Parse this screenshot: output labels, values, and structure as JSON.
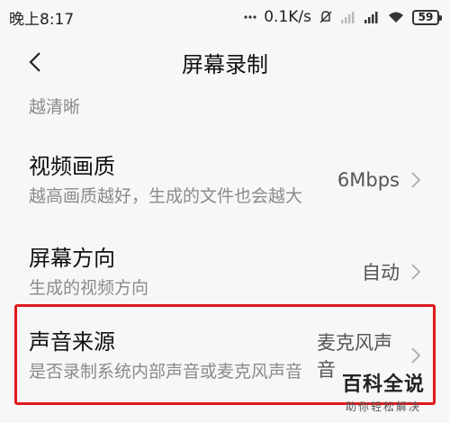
{
  "status": {
    "time": "晚上8:17",
    "net_speed": "0.1K/s",
    "battery": "59"
  },
  "header": {
    "title": "屏幕录制"
  },
  "list": {
    "partial_text": "越清晰",
    "items": [
      {
        "title": "视频画质",
        "subtitle": "越高画质越好，生成的文件也会越大",
        "value": "6Mbps"
      },
      {
        "title": "屏幕方向",
        "subtitle": "生成的视频方向",
        "value": "自动"
      },
      {
        "title": "声音来源",
        "subtitle": "是否录制系统内部声音或麦克风声音",
        "value": "麦克风声音"
      }
    ]
  },
  "watermark": {
    "main": "百科全说",
    "sub": "助你轻松解决"
  },
  "colors": {
    "highlight": "#e0191e",
    "subtitle": "#8a8a8a"
  }
}
